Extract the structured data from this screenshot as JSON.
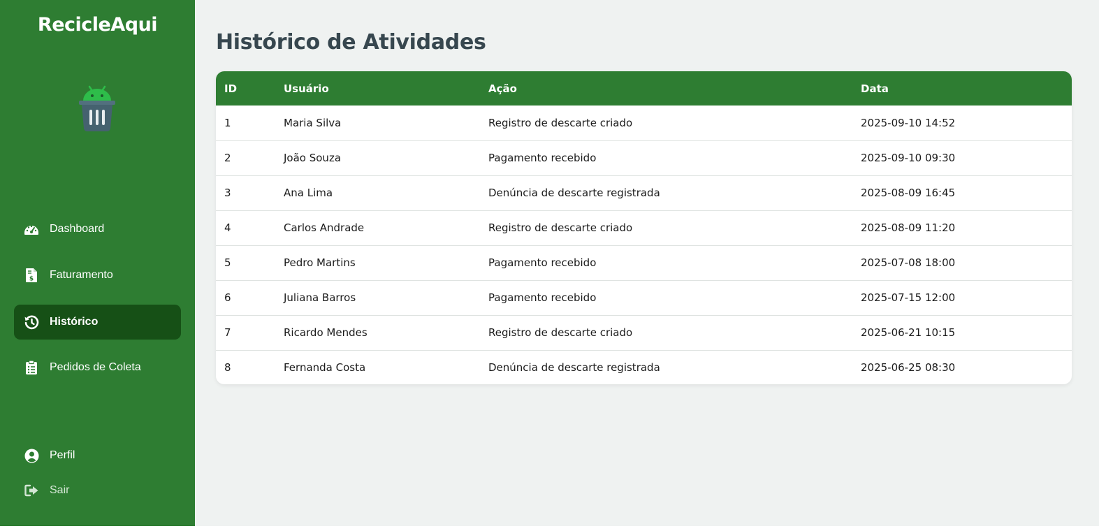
{
  "brand": {
    "name": "RecicleAqui"
  },
  "sidebar": {
    "items": [
      {
        "label": "Dashboard",
        "icon": "gauge-icon"
      },
      {
        "label": "Faturamento",
        "icon": "invoice-icon"
      },
      {
        "label": "Histórico",
        "icon": "history-icon",
        "active": true
      },
      {
        "label": "Pedidos de Coleta",
        "icon": "clipboard-icon"
      }
    ],
    "footer": [
      {
        "label": "Perfil",
        "icon": "user-circle-icon"
      },
      {
        "label": "Sair",
        "icon": "logout-icon"
      }
    ]
  },
  "page": {
    "title": "Histórico de Atividades"
  },
  "table": {
    "headers": [
      "ID",
      "Usuário",
      "Ação",
      "Data"
    ],
    "rows": [
      {
        "id": "1",
        "usuario": "Maria Silva",
        "acao": "Registro de descarte criado",
        "data": "2025-09-10 14:52"
      },
      {
        "id": "2",
        "usuario": "João Souza",
        "acao": "Pagamento recebido",
        "data": "2025-09-10 09:30"
      },
      {
        "id": "3",
        "usuario": "Ana Lima",
        "acao": "Denúncia de descarte registrada",
        "data": "2025-08-09 16:45"
      },
      {
        "id": "4",
        "usuario": "Carlos Andrade",
        "acao": "Registro de descarte criado",
        "data": "2025-08-09 11:20"
      },
      {
        "id": "5",
        "usuario": "Pedro Martins",
        "acao": "Pagamento recebido",
        "data": "2025-07-08 18:00"
      },
      {
        "id": "6",
        "usuario": "Juliana Barros",
        "acao": "Pagamento recebido",
        "data": "2025-07-15 12:00"
      },
      {
        "id": "7",
        "usuario": "Ricardo Mendes",
        "acao": "Registro de descarte criado",
        "data": "2025-06-21 10:15"
      },
      {
        "id": "8",
        "usuario": "Fernanda Costa",
        "acao": "Denúncia de descarte registrada",
        "data": "2025-06-25 08:30"
      }
    ]
  },
  "colors": {
    "sidebar": "#2e7d32",
    "sidebar_active": "#165016",
    "header_row": "#2e7d32",
    "background": "#eff2f1",
    "title": "#37474f"
  }
}
